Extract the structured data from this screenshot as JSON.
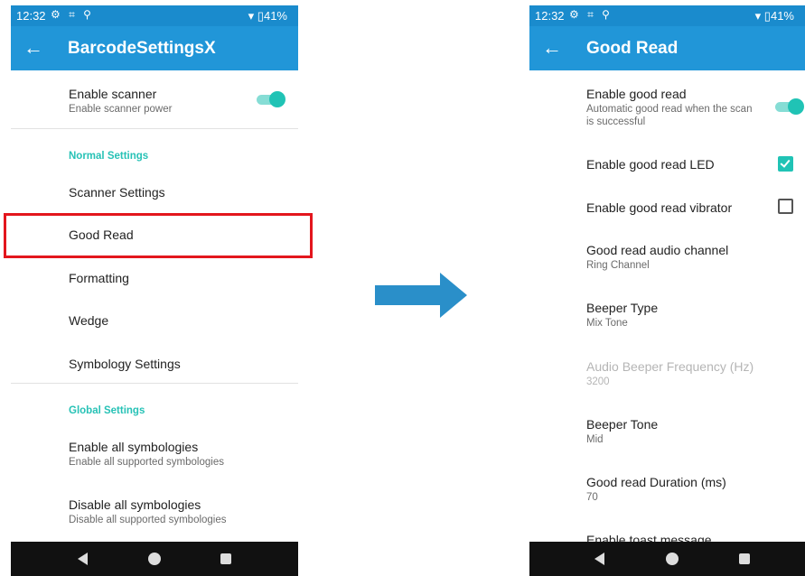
{
  "status": {
    "time": "12:32",
    "battery": "41%"
  },
  "left": {
    "title": "BarcodeSettingsX",
    "enable_scanner": {
      "title": "Enable scanner",
      "subtitle": "Enable scanner power",
      "on": true
    },
    "normal_section": "Normal Settings",
    "items": [
      "Scanner Settings",
      "Good Read",
      "Formatting",
      "Wedge",
      "Symbology Settings"
    ],
    "highlighted_item": "Good Read",
    "global_section": "Global Settings",
    "enable_all": {
      "title": "Enable all symbologies",
      "subtitle": "Enable all supported symbologies"
    },
    "disable_all": {
      "title": "Disable all symbologies",
      "subtitle": "Disable all supported symbologies"
    }
  },
  "right": {
    "title": "Good Read",
    "enable_good_read": {
      "title": "Enable good read",
      "subtitle": "Automatic good read when the scan is successful",
      "on": true
    },
    "led": {
      "title": "Enable good read LED",
      "checked": true
    },
    "vibrator": {
      "title": "Enable good read vibrator",
      "checked": false
    },
    "audio_channel": {
      "title": "Good read audio channel",
      "value": "Ring Channel"
    },
    "beeper_type": {
      "title": "Beeper Type",
      "value": "Mix Tone"
    },
    "beeper_frequency": {
      "title": "Audio Beeper Frequency (Hz)",
      "value": "3200",
      "disabled": true
    },
    "beeper_tone": {
      "title": "Beeper Tone",
      "value": "Mid"
    },
    "duration": {
      "title": "Good read Duration (ms)",
      "value": "70"
    },
    "toast": {
      "title": "Enable toast message"
    }
  },
  "colors": {
    "statusbar": "#1a8bcd",
    "appbar": "#2196d8",
    "accent": "#20c3b5",
    "highlight": "#e3161d",
    "arrow": "#2a8fc9"
  },
  "icons": {
    "back": "arrow-left-icon",
    "settings": "gear-icon",
    "wifi": "wifi-icon",
    "battery": "battery-icon",
    "flow": "arrow-right-icon"
  }
}
